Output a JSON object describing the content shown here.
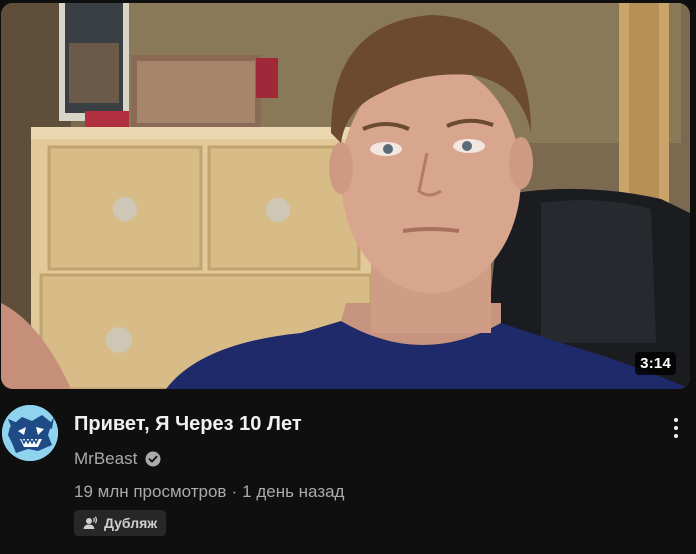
{
  "video": {
    "duration": "3:14",
    "title": "Привет, Я Через 10 Лет"
  },
  "channel": {
    "name": "MrBeast",
    "verified": true,
    "avatar_icon": "mrbeast-logo-icon",
    "avatar_color": "#8fd3ee"
  },
  "meta": {
    "views": "19 млн просмотров",
    "separator": "·",
    "age": "1 день назад"
  },
  "badge": {
    "label": "Дубляж",
    "icon": "dubbing-icon"
  },
  "menu": {
    "icon": "more-vertical-icon"
  }
}
